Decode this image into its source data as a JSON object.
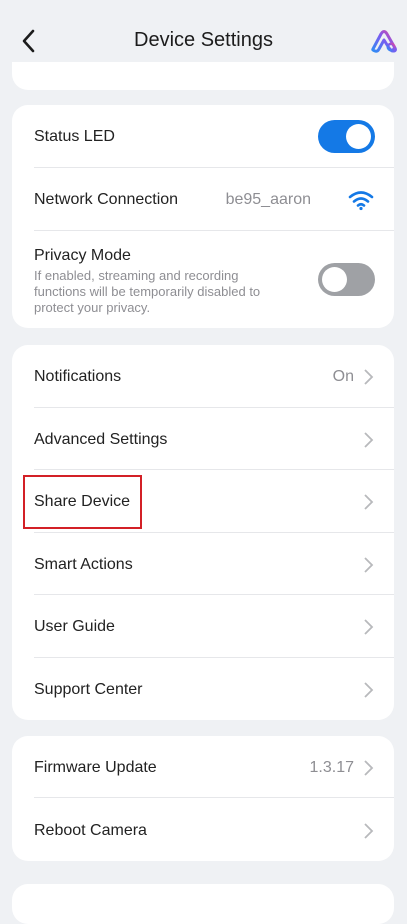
{
  "header": {
    "title": "Device Settings"
  },
  "card1": {
    "status_led": {
      "label": "Status LED",
      "enabled": true
    },
    "network": {
      "label": "Network Connection",
      "value": "be95_aaron"
    },
    "privacy": {
      "label": "Privacy Mode",
      "description": "If enabled, streaming and recording functions will be temporarily disabled to protect your privacy.",
      "enabled": false
    }
  },
  "card2": {
    "items": [
      {
        "label": "Notifications",
        "value": "On"
      },
      {
        "label": "Advanced Settings",
        "value": ""
      },
      {
        "label": "Share Device",
        "value": ""
      },
      {
        "label": "Smart Actions",
        "value": ""
      },
      {
        "label": "User Guide",
        "value": ""
      },
      {
        "label": "Support Center",
        "value": ""
      }
    ]
  },
  "card3": {
    "items": [
      {
        "label": "Firmware Update",
        "value": "1.3.17"
      },
      {
        "label": "Reboot Camera",
        "value": ""
      }
    ]
  },
  "icons": [
    "back-arrow-icon",
    "brand-logo-icon",
    "wifi-icon",
    "chevron-right-icon"
  ],
  "colors": {
    "accent": "#1479e6",
    "toggle_off": "#9fa1a5",
    "highlight": "#d32026",
    "background": "#eff1f4"
  }
}
